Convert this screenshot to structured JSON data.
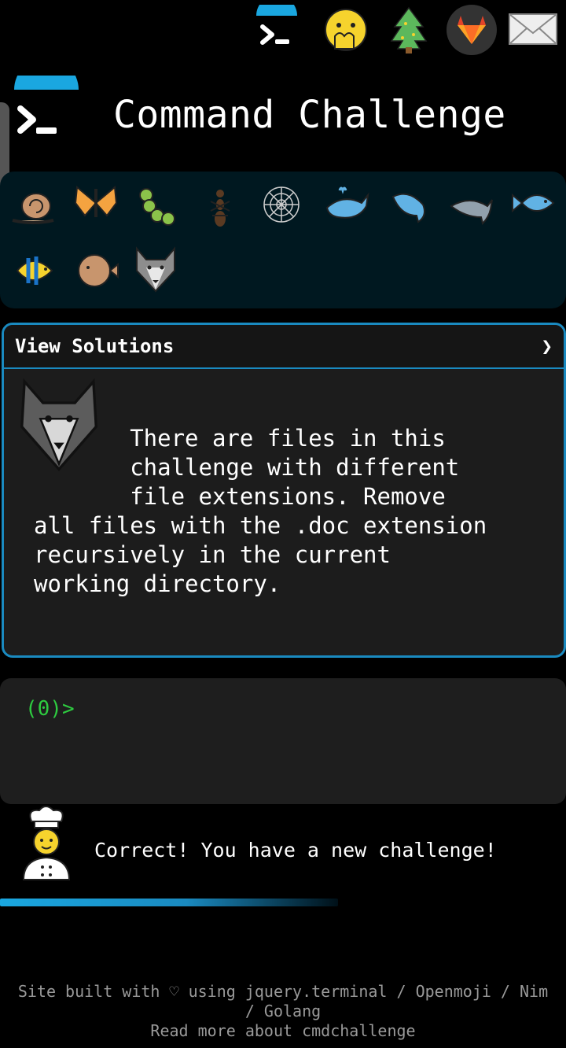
{
  "header": {
    "title": "Command Challenge"
  },
  "top_icons": [
    "terminal-icon",
    "hand-over-mouth-icon",
    "tree-icon",
    "gitlab-icon",
    "mail-icon"
  ],
  "badges": [
    "snail-icon",
    "butterfly-icon",
    "caterpillar-icon",
    "ant-icon",
    "spider-web-icon",
    "whale-icon",
    "spouting-whale-icon",
    "dolphin-icon",
    "fish-icon",
    "tropical-fish-icon",
    "blowfish-icon",
    "wolf-icon"
  ],
  "panel": {
    "title": "View Solutions",
    "chevron": "❯",
    "challenge": "       There are files in this\n       challenge with different\n       file extensions. Remove\nall files with the .doc extension\nrecursively in the current\nworking directory."
  },
  "terminal": {
    "prompt": "(0)>"
  },
  "status": {
    "message": "Correct! You have a new challenge!"
  },
  "footer": {
    "line1": "Site built with ♡ using jquery.terminal / Openmoji / Nim",
    "line2": "/ Golang",
    "line3": "Read more about cmdchallenge"
  },
  "colors": {
    "accent": "#1a8ac0",
    "prompt": "#2ecc40",
    "background": "#000000"
  }
}
